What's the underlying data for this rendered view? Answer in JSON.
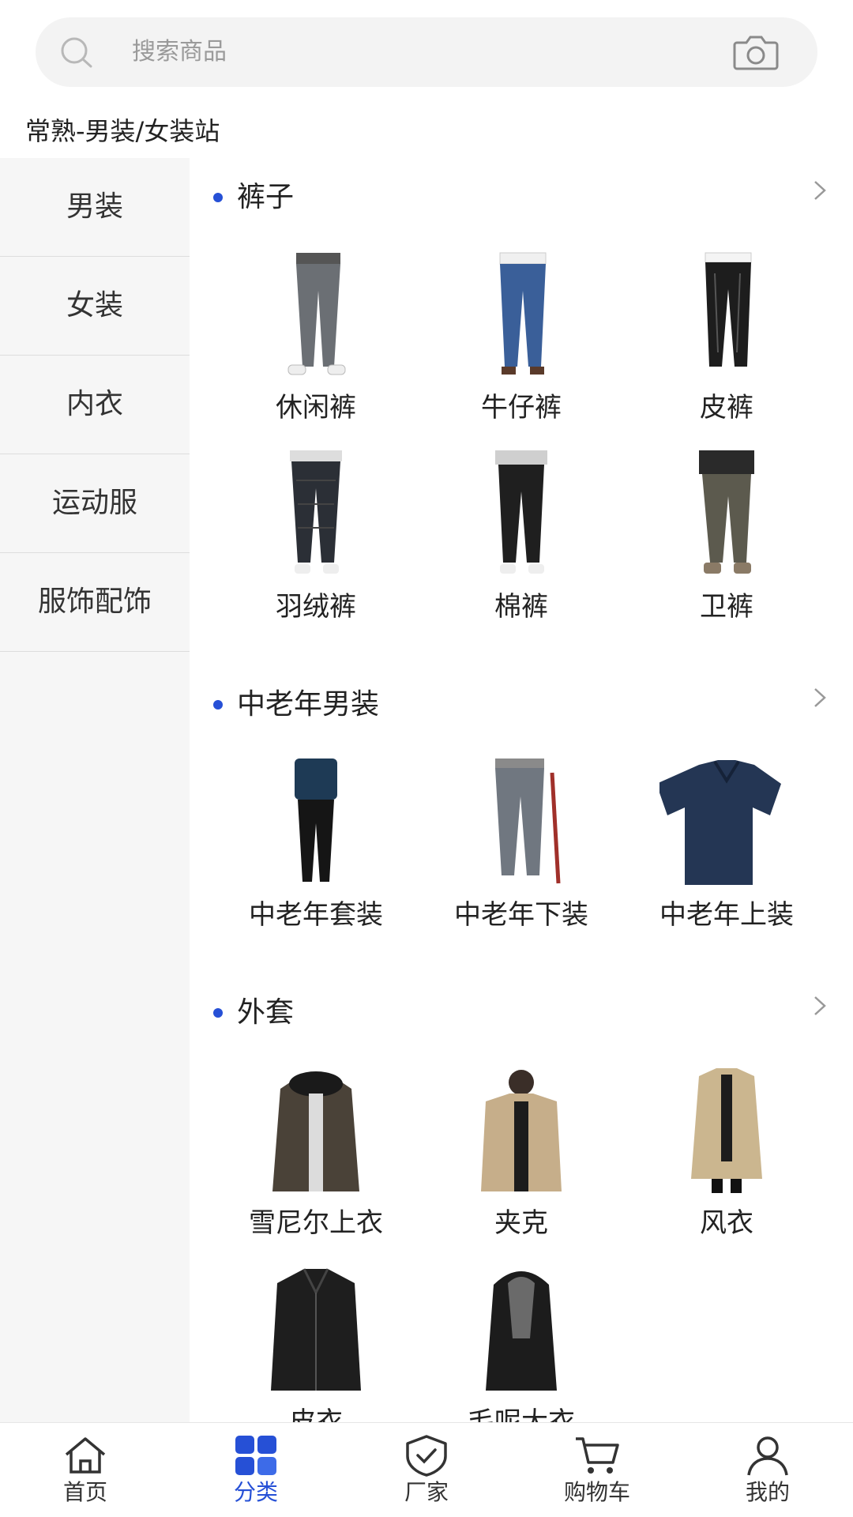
{
  "search": {
    "placeholder": "搜索商品",
    "left_icon": "search-icon",
    "right_icon": "camera-icon"
  },
  "site_title": "常熟-男装/女装站",
  "sidebar": {
    "items": [
      {
        "label": "男装",
        "active": true
      },
      {
        "label": "女装",
        "active": false
      },
      {
        "label": "内衣",
        "active": false
      },
      {
        "label": "运动服",
        "active": false
      },
      {
        "label": "服饰配饰",
        "active": false
      }
    ]
  },
  "sections": [
    {
      "title": "裤子",
      "items": [
        {
          "label": "休闲裤",
          "icon": "casual-pants-image"
        },
        {
          "label": "牛仔裤",
          "icon": "jeans-image"
        },
        {
          "label": "皮裤",
          "icon": "leather-pants-image"
        },
        {
          "label": "羽绒裤",
          "icon": "down-pants-image"
        },
        {
          "label": "棉裤",
          "icon": "cotton-pants-image"
        },
        {
          "label": "卫裤",
          "icon": "sweatpants-image"
        }
      ]
    },
    {
      "title": "中老年男装",
      "items": [
        {
          "label": "中老年套装",
          "icon": "senior-suit-image"
        },
        {
          "label": "中老年下装",
          "icon": "senior-bottoms-image"
        },
        {
          "label": "中老年上装",
          "icon": "senior-top-image"
        }
      ]
    },
    {
      "title": "外套",
      "items": [
        {
          "label": "雪尼尔上衣",
          "icon": "chenille-jacket-image"
        },
        {
          "label": "夹克",
          "icon": "jacket-image"
        },
        {
          "label": "风衣",
          "icon": "trench-coat-image"
        },
        {
          "label": "皮衣",
          "icon": "leather-jacket-image"
        },
        {
          "label": "毛呢大衣",
          "icon": "wool-coat-image"
        }
      ]
    }
  ],
  "bottom_nav": [
    {
      "label": "首页",
      "icon": "home-icon",
      "active": false
    },
    {
      "label": "分类",
      "icon": "category-icon",
      "active": true
    },
    {
      "label": "厂家",
      "icon": "shield-check-icon",
      "active": false
    },
    {
      "label": "购物车",
      "icon": "cart-icon",
      "active": false
    },
    {
      "label": "我的",
      "icon": "user-icon",
      "active": false
    }
  ],
  "colors": {
    "accent": "#2650d6",
    "sidebar_bg": "#f6f6f6",
    "search_bg": "#f3f3f3"
  }
}
